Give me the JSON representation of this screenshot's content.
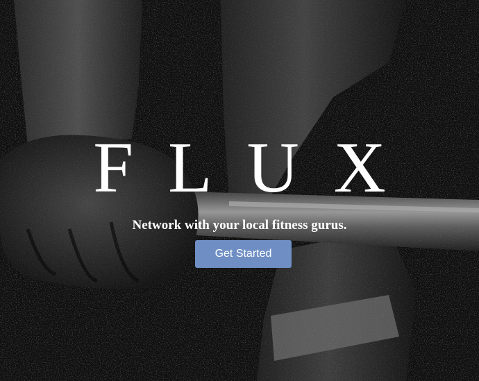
{
  "hero": {
    "background": "grayscale photo of a fist gripping a barbell over a gym floor",
    "title": "FLUX",
    "tagline": "Network with your local fitness gurus.",
    "cta_label": "Get Started",
    "cta_color": "#6f8fc4"
  }
}
